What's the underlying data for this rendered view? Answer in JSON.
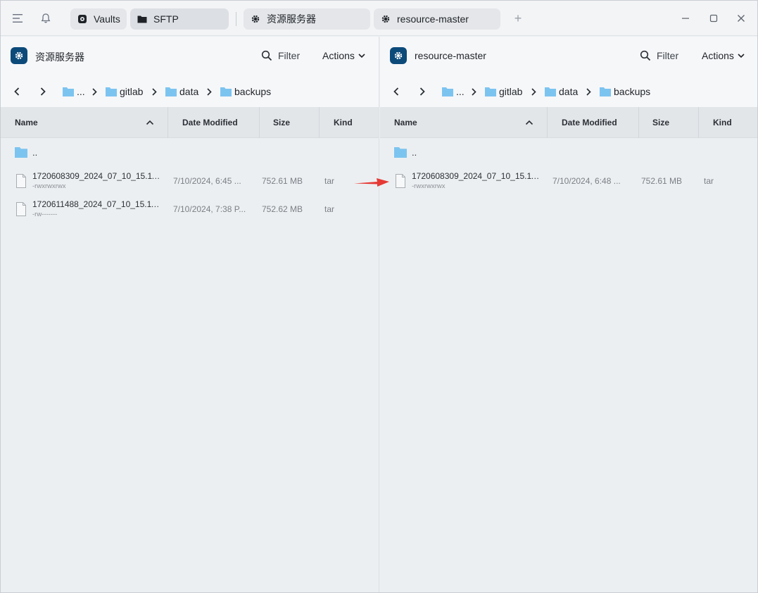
{
  "titlebar": {
    "tabs": [
      {
        "label": "Vaults",
        "icon": "vault-icon"
      },
      {
        "label": "SFTP",
        "icon": "folder-icon"
      },
      {
        "label": "资源服务器",
        "icon": "gear-icon"
      },
      {
        "label": "resource-master",
        "icon": "gear-icon"
      }
    ],
    "add_tab": "+"
  },
  "colors": {
    "host_icon": "#0c4a7a",
    "folder": "#7cc4f0",
    "arrow": "#e53935"
  },
  "left": {
    "host": "资源服务器",
    "filter": "Filter",
    "actions": "Actions",
    "breadcrumb": [
      "...",
      "gitlab",
      "data",
      "backups"
    ],
    "columns": {
      "name": "Name",
      "date": "Date Modified",
      "size": "Size",
      "kind": "Kind"
    },
    "parent": "..",
    "files": [
      {
        "name": "1720608309_2024_07_10_15.11...",
        "perm": "-rwxrwxrwx",
        "date": "7/10/2024, 6:45 ...",
        "size": "752.61 MB",
        "kind": "tar"
      },
      {
        "name": "1720611488_2024_07_10_15.11....",
        "perm": "-rw-------",
        "date": "7/10/2024, 7:38 P...",
        "size": "752.62 MB",
        "kind": "tar"
      }
    ]
  },
  "right": {
    "host": "resource-master",
    "filter": "Filter",
    "actions": "Actions",
    "breadcrumb": [
      "...",
      "gitlab",
      "data",
      "backups"
    ],
    "columns": {
      "name": "Name",
      "date": "Date Modified",
      "size": "Size",
      "kind": "Kind"
    },
    "parent": "..",
    "files": [
      {
        "name": "1720608309_2024_07_10_15.11...",
        "perm": "-rwxrwxrwx",
        "date": "7/10/2024, 6:48 ...",
        "size": "752.61 MB",
        "kind": "tar"
      }
    ]
  }
}
